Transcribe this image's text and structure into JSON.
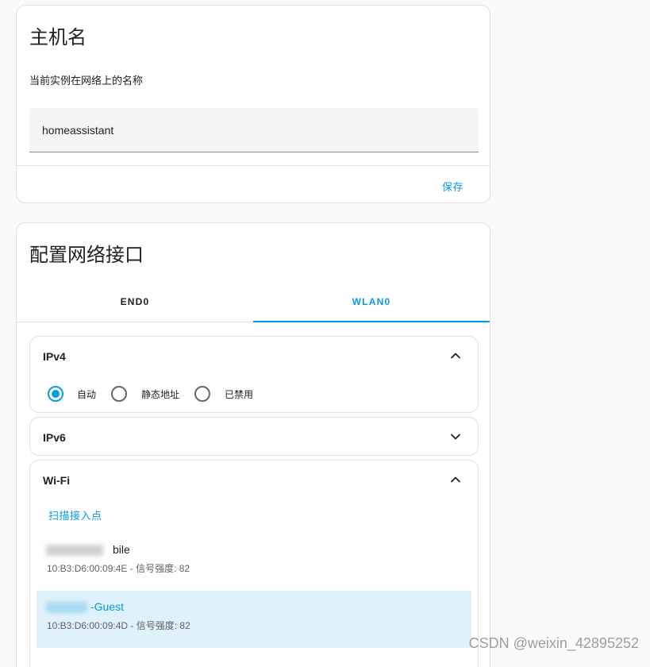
{
  "hostname_card": {
    "title": "主机名",
    "description": "当前实例在网络上的名称",
    "hostname_value": "homeassistant",
    "save_label": "保存"
  },
  "network_card": {
    "title": "配置网络接口",
    "tabs": [
      {
        "label": "END0",
        "active": false
      },
      {
        "label": "WLAN0",
        "active": true
      }
    ],
    "ipv4": {
      "title": "IPv4",
      "expanded": true,
      "options": [
        {
          "label": "自动",
          "checked": true
        },
        {
          "label": "静态地址",
          "checked": false
        },
        {
          "label": "已禁用",
          "checked": false
        }
      ]
    },
    "ipv6": {
      "title": "IPv6",
      "expanded": false
    },
    "wifi": {
      "title": "Wi-Fi",
      "expanded": true,
      "scan_label": "扫描接入点",
      "networks": [
        {
          "name_visible": "bile",
          "meta": "10:B3:D6:00:09:4E - 信号强度: 82",
          "selected": false
        },
        {
          "name_visible": "-Guest",
          "meta": "10:B3:D6:00:09:4D - 信号强度: 82",
          "selected": true
        }
      ]
    }
  },
  "watermark": "CSDN @weixin_42895252",
  "colors": {
    "accent": "#039be5",
    "selected_bg": "#dff2fb",
    "border": "#e0e0e0"
  }
}
